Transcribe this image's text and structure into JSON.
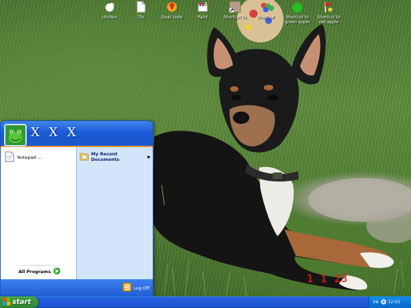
{
  "desktop": {
    "icons": [
      {
        "label": "chicken",
        "icon": "chicken-icon"
      },
      {
        "label": "Tto",
        "icon": "document-icon"
      },
      {
        "label": "Goat code",
        "icon": "game-icon"
      },
      {
        "label": "Paint",
        "icon": "paint-icon"
      },
      {
        "label": "Shortcut to",
        "icon": "shortcut-icon"
      },
      {
        "label": "Shortcut",
        "icon": "candy-icon"
      },
      {
        "label": "Shortcut to\ngreen apple",
        "icon": "green-apple-icon"
      },
      {
        "label": "Shortcut to\nred apple",
        "icon": "red-flag-icon"
      }
    ],
    "photo_timestamp": "1 1 23"
  },
  "start_menu": {
    "user_name": "X X X",
    "avatar_icon": "frog-avatar-icon",
    "pinned": [
      {
        "label": "Notepad ...",
        "icon": "document-icon"
      }
    ],
    "all_programs_label": "All Programs",
    "right_items": [
      {
        "label": "My Recent Documents",
        "icon": "recent-documents-icon",
        "has_submenu": true
      }
    ],
    "log_off_label": "Log Off"
  },
  "taskbar": {
    "start_label": "start",
    "tray": {
      "language": "EN",
      "clock": "12:03"
    }
  },
  "colors": {
    "taskbar_blue": "#245edc",
    "start_green": "#3c9a3c",
    "menu_header_blue": "#1a5bd6",
    "menu_right_panel": "#d3e5fa",
    "accent_orange": "#f39a2e",
    "timestamp_red": "#e01818"
  }
}
